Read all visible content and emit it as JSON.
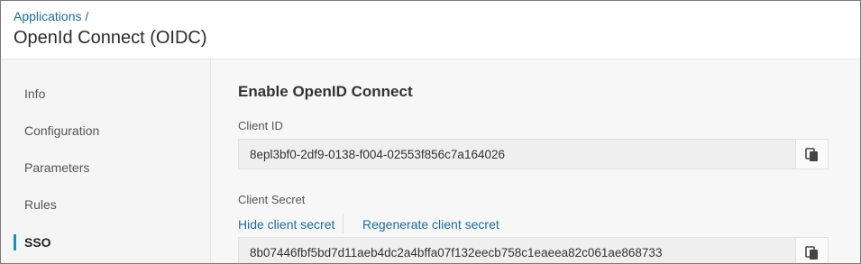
{
  "header": {
    "breadcrumb": "Applications /",
    "title": "OpenId Connect (OIDC)"
  },
  "sidebar": {
    "items": [
      {
        "label": "Info"
      },
      {
        "label": "Configuration"
      },
      {
        "label": "Parameters"
      },
      {
        "label": "Rules"
      },
      {
        "label": "SSO",
        "active": true
      }
    ]
  },
  "main": {
    "section_title": "Enable OpenID Connect",
    "client_id": {
      "label": "Client ID",
      "value": "8epl3bf0-2df9-0138-f004-02553f856c7a164026"
    },
    "client_secret": {
      "label": "Client Secret",
      "hide_link": "Hide client secret",
      "regenerate_link": "Regenerate client secret",
      "value": "8b07446fbf5bd7d11aeb4dc2a4bffa07f132eecb758c1eaeea82c061ae868733"
    },
    "copy_icon": "copy-icon"
  },
  "colors": {
    "link": "#1b6e9a",
    "active_indicator": "#1b8fc4"
  }
}
